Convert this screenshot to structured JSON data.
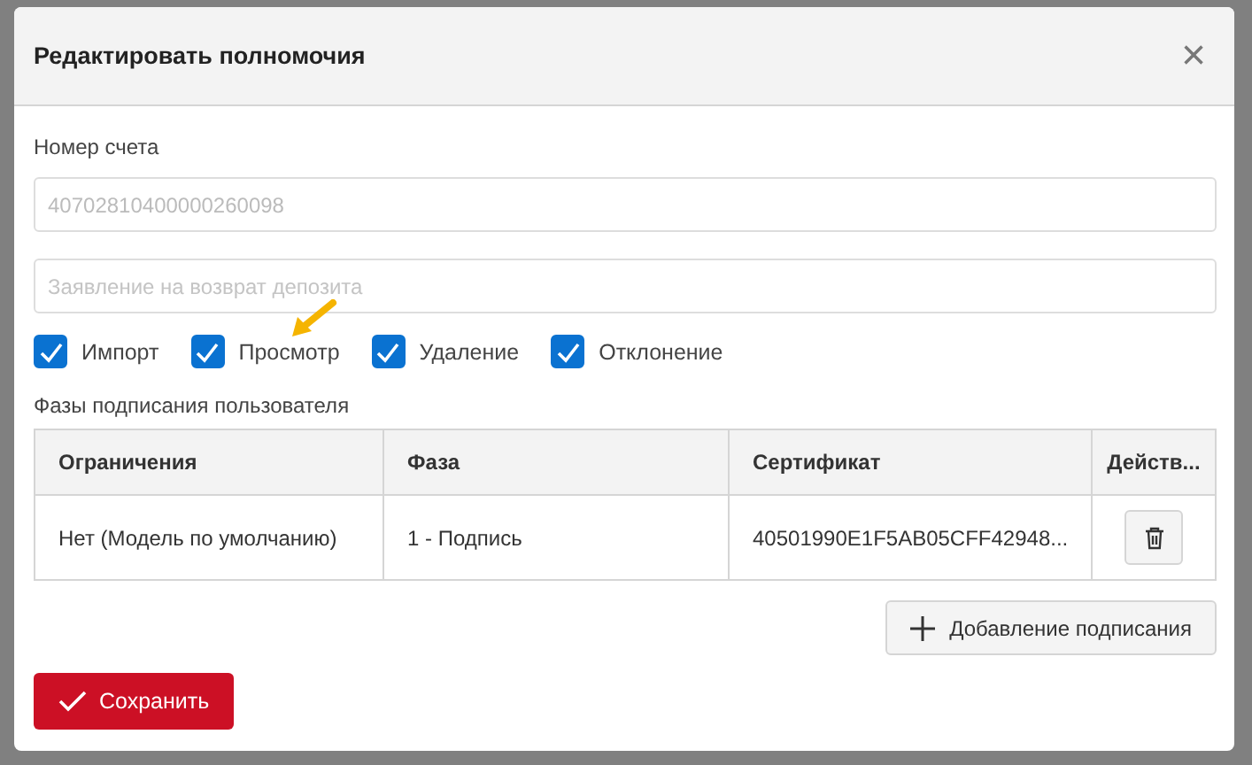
{
  "dialog": {
    "title": "Редактировать полномочия",
    "close_icon": "×"
  },
  "account": {
    "label": "Номер счета",
    "value": "40702810400000260098",
    "disabled": true
  },
  "statement_field": {
    "placeholder": "Заявление на возврат депозита"
  },
  "permissions": [
    {
      "label": "Импорт",
      "checked": true
    },
    {
      "label": "Просмотр",
      "checked": true
    },
    {
      "label": "Удаление",
      "checked": true
    },
    {
      "label": "Отклонение",
      "checked": true
    }
  ],
  "phases": {
    "title": "Фазы подписания пользователя",
    "columns": [
      "Ограничения",
      "Фаза",
      "Сертификат",
      "Действ..."
    ],
    "rows": [
      {
        "cells": [
          "Нет (Модель по умолчанию)",
          "1 - Подпись",
          "40501990E1F5AB05CFF42948..."
        ]
      }
    ]
  },
  "add_button": "Добавление подписания",
  "save_button": "Сохранить"
}
